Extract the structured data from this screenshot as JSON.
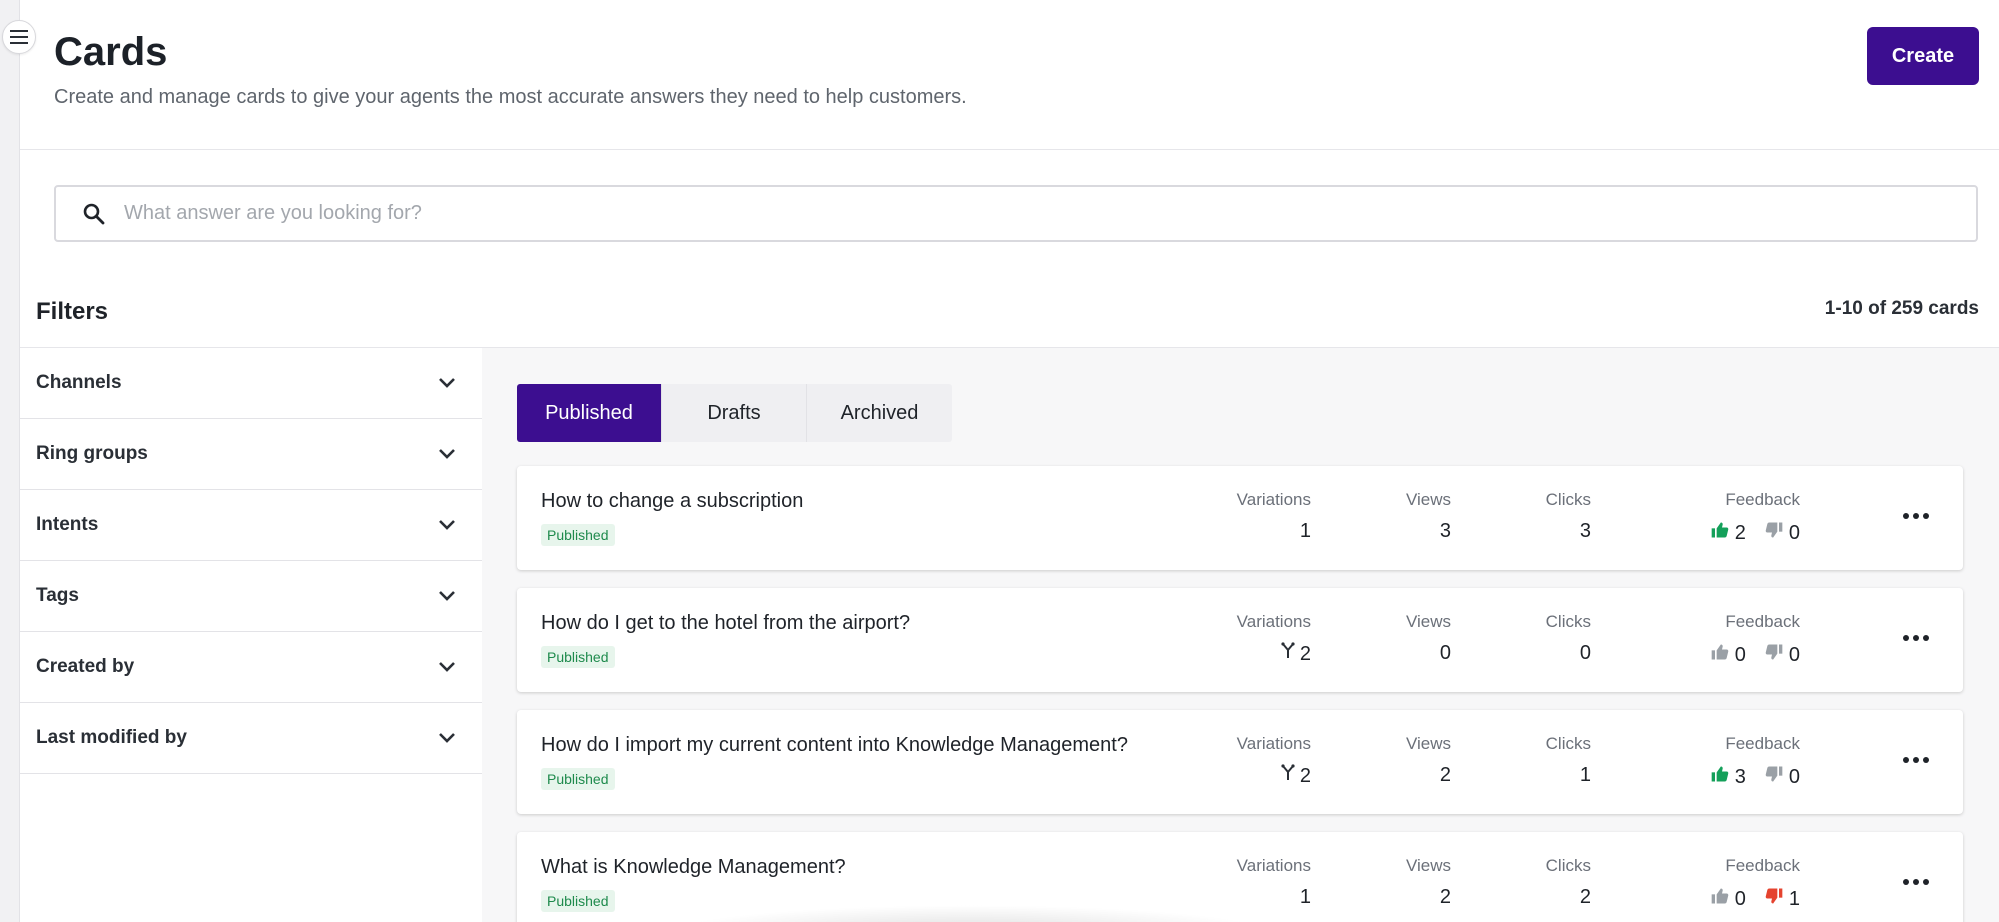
{
  "header": {
    "title": "Cards",
    "subtitle": "Create and manage cards to give your agents the most accurate answers they need to help customers.",
    "create_label": "Create"
  },
  "search": {
    "placeholder": "What answer are you looking for?",
    "value": ""
  },
  "filters": {
    "title": "Filters",
    "items": [
      {
        "label": "Channels"
      },
      {
        "label": "Ring groups"
      },
      {
        "label": "Intents"
      },
      {
        "label": "Tags"
      },
      {
        "label": "Created by"
      },
      {
        "label": "Last modified by"
      }
    ]
  },
  "results": {
    "count_label": "1-10 of 259 cards"
  },
  "tabs": [
    {
      "label": "Published",
      "active": true
    },
    {
      "label": "Drafts",
      "active": false
    },
    {
      "label": "Archived",
      "active": false
    }
  ],
  "columns": {
    "variations": "Variations",
    "views": "Views",
    "clicks": "Clicks",
    "feedback": "Feedback"
  },
  "cards": [
    {
      "title": "How to change a subscription",
      "status": "Published",
      "variations": "1",
      "variations_icon": false,
      "views": "3",
      "clicks": "3",
      "likes": "2",
      "likes_active": true,
      "dislikes": "0",
      "dislikes_active": false
    },
    {
      "title": "How do I get to the hotel from the airport?",
      "status": "Published",
      "variations": "2",
      "variations_icon": true,
      "views": "0",
      "clicks": "0",
      "likes": "0",
      "likes_active": false,
      "dislikes": "0",
      "dislikes_active": false
    },
    {
      "title": "How do I import my current content into Knowledge Management?",
      "status": "Published",
      "variations": "2",
      "variations_icon": true,
      "views": "2",
      "clicks": "1",
      "likes": "3",
      "likes_active": true,
      "dislikes": "0",
      "dislikes_active": false
    },
    {
      "title": "What is Knowledge Management?",
      "status": "Published",
      "variations": "1",
      "variations_icon": false,
      "views": "2",
      "clicks": "2",
      "likes": "0",
      "likes_active": false,
      "dislikes": "1",
      "dislikes_active": true
    }
  ],
  "colors": {
    "primary": "#3c0e90",
    "like_active": "#14a05a",
    "dislike_active": "#e5432f",
    "inactive_icon": "#9aa0a6",
    "status_text": "#1e8a4c",
    "status_bg": "#e7f5ec"
  },
  "icons": {
    "menu": "hamburger-icon",
    "search": "search-icon",
    "chevron": "chevron-down-icon",
    "variations": "branch-icon",
    "like": "thumbs-up-icon",
    "dislike": "thumbs-down-icon",
    "more": "more-horizontal-icon"
  }
}
